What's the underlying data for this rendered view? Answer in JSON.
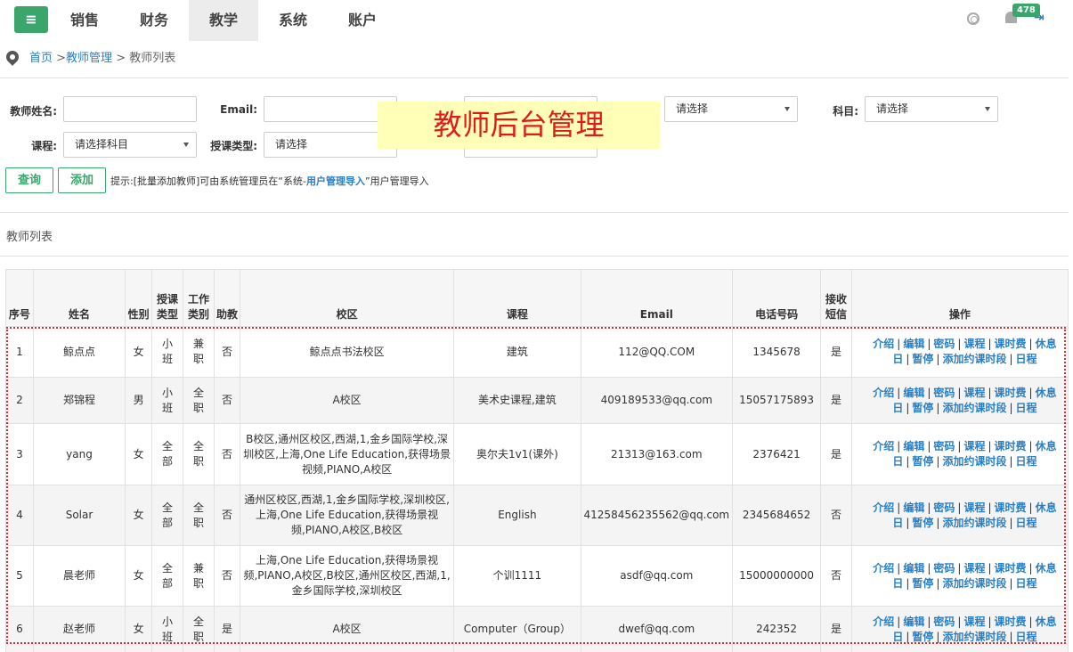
{
  "topnav": {
    "menu_icon": "menu-icon",
    "items": [
      "销售",
      "财务",
      "教学",
      "系统",
      "账户"
    ],
    "active": "教学",
    "badge_count": "478"
  },
  "breadcrumb": {
    "home": "首页",
    "sep1": " >",
    "parent": "教师管理",
    "sep2": " > ",
    "current": "教师列表"
  },
  "form": {
    "teacher_name_label": "教师姓名:",
    "email_label": "Email:",
    "select_placeholder": "请选择",
    "subject_label": "科目:",
    "course_label": "课程:",
    "course_placeholder": "请选择科目",
    "class_type_label": "授课类型:",
    "overlay_text": "教师后台管理"
  },
  "buttons": {
    "query": "查询",
    "add": "添加"
  },
  "hint": {
    "prefix": "提示:[批量添加教师]可由系统管理员在“系统-",
    "link": "用户管理导入",
    "suffix": "”用户管理导入"
  },
  "section_title": "教师列表",
  "table": {
    "headers": [
      "序号",
      "姓名",
      "性别",
      "授课\n类型",
      "工作\n类别",
      "助教",
      "校区",
      "课程",
      "Email",
      "电话号码",
      "接收\n短信",
      "操作"
    ],
    "ops": [
      "介绍",
      "编辑",
      "密码",
      "课程",
      "课时费",
      "休息日",
      "暂停",
      "添加约课时段",
      "日程"
    ],
    "rows": [
      {
        "no": "1",
        "name": "鲸点点",
        "gender": "女",
        "type": "小班",
        "work": "兼职",
        "ta": "否",
        "campus": "鲸点点书法校区",
        "course": "建筑",
        "email": "112@QQ.COM",
        "phone": "1345678",
        "sms": "是"
      },
      {
        "no": "2",
        "name": "郑锦程",
        "gender": "男",
        "type": "小班",
        "work": "全职",
        "ta": "否",
        "campus": "A校区",
        "course": "美术史课程,建筑",
        "email": "409189533@qq.com",
        "phone": "15057175893",
        "sms": "是"
      },
      {
        "no": "3",
        "name": "yang",
        "gender": "女",
        "type": "全部",
        "work": "全职",
        "ta": "否",
        "campus": "B校区,通州区校区,西湖,1,金乡国际学校,深圳校区,上海,One Life Education,获得场景视频,PIANO,A校区",
        "course": "奥尔夫1v1(课外)",
        "email": "21313@163.com",
        "phone": "2376421",
        "sms": "是"
      },
      {
        "no": "4",
        "name": "Solar",
        "gender": "女",
        "type": "全部",
        "work": "全职",
        "ta": "否",
        "campus": "通州区校区,西湖,1,金乡国际学校,深圳校区,上海,One Life Education,获得场景视频,PIANO,A校区,B校区",
        "course": "English",
        "email": "41258456235562@qq.com",
        "phone": "2345684652",
        "sms": "否"
      },
      {
        "no": "5",
        "name": "晨老师",
        "gender": "女",
        "type": "全部",
        "work": "兼职",
        "ta": "否",
        "campus": "上海,One Life Education,获得场景视频,PIANO,A校区,B校区,通州区校区,西湖,1,金乡国际学校,深圳校区",
        "course": "个训1111",
        "email": "asdf@qq.com",
        "phone": "15000000000",
        "sms": "否"
      },
      {
        "no": "6",
        "name": "赵老师",
        "gender": "女",
        "type": "小班",
        "work": "全职",
        "ta": "是",
        "campus": "A校区",
        "course": "Computer（Group）",
        "email": "dwef@qq.com",
        "phone": "242352",
        "sms": "是"
      }
    ]
  }
}
